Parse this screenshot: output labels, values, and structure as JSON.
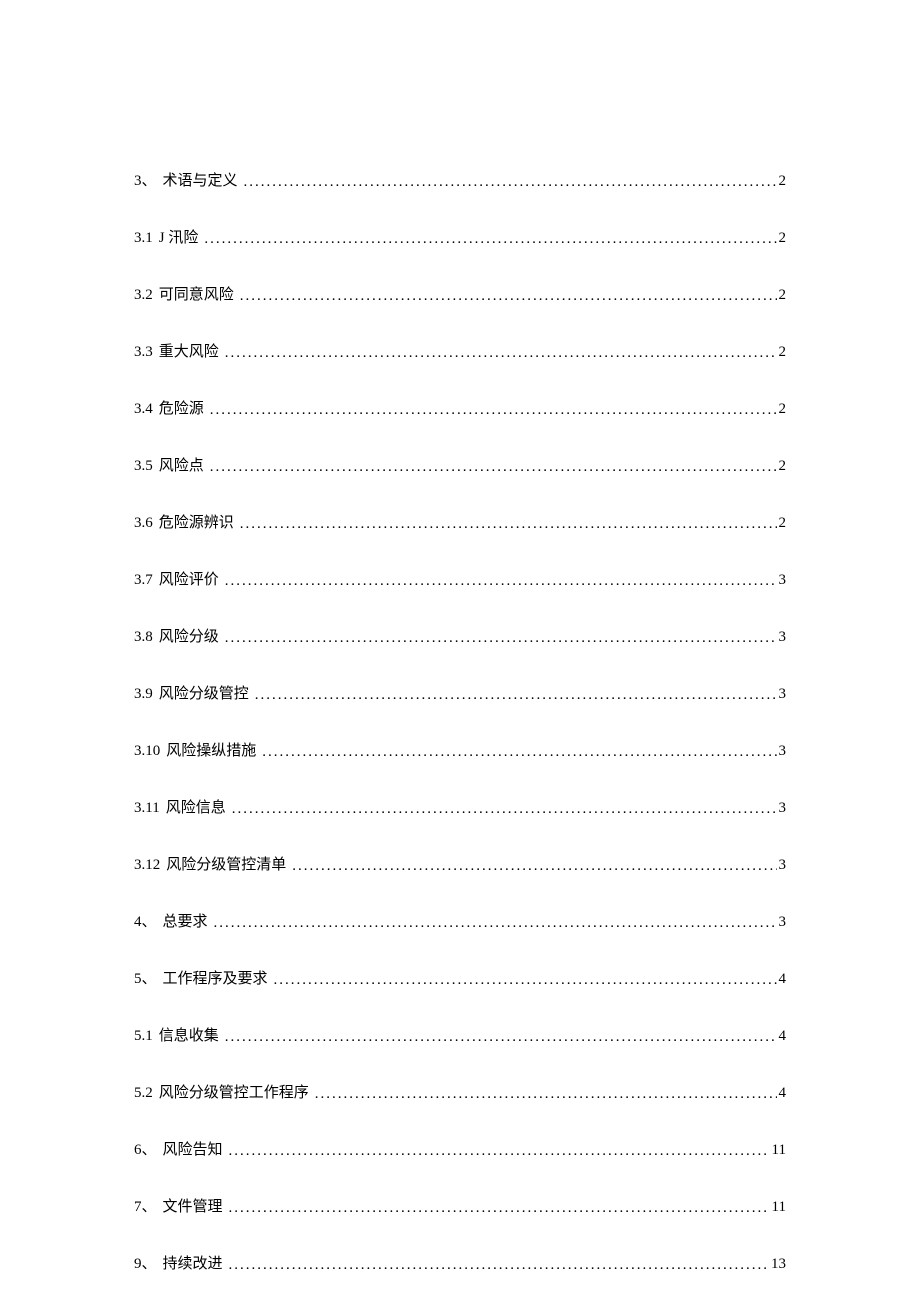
{
  "toc": [
    {
      "number": "3、",
      "title": "术语与定义",
      "page": "2"
    },
    {
      "number": "3.1",
      "title": "J 汛险",
      "page": "2"
    },
    {
      "number": "3.2",
      "title": "可同意风险",
      "page": "2"
    },
    {
      "number": "3.3",
      "title": "重大风险",
      "page": "2"
    },
    {
      "number": "3.4",
      "title": "危险源",
      "page": "2"
    },
    {
      "number": "3.5",
      "title": "风险点",
      "page": "2"
    },
    {
      "number": "3.6",
      "title": "危险源辨识",
      "page": "2"
    },
    {
      "number": "3.7",
      "title": "风险评价",
      "page": "3"
    },
    {
      "number": "3.8",
      "title": "风险分级",
      "page": "3"
    },
    {
      "number": "3.9",
      "title": "风险分级管控",
      "page": "3"
    },
    {
      "number": "3.10",
      "title": "风险操纵措施",
      "page": "3"
    },
    {
      "number": "3.11",
      "title": "风险信息",
      "page": "3"
    },
    {
      "number": "3.12",
      "title": "风险分级管控清单",
      "page": "3"
    },
    {
      "number": "4、",
      "title": "总要求",
      "page": "3"
    },
    {
      "number": "5、",
      "title": "工作程序及要求",
      "page": "4"
    },
    {
      "number": "5.1",
      "title": "信息收集",
      "page": "4"
    },
    {
      "number": "5.2",
      "title": "风险分级管控工作程序",
      "page": "4"
    },
    {
      "number": "6、",
      "title": "风险告知",
      "page": "11"
    },
    {
      "number": "7、",
      "title": "文件管理",
      "page": "11"
    },
    {
      "number": "9、",
      "title": "持续改进",
      "page": "13"
    }
  ]
}
